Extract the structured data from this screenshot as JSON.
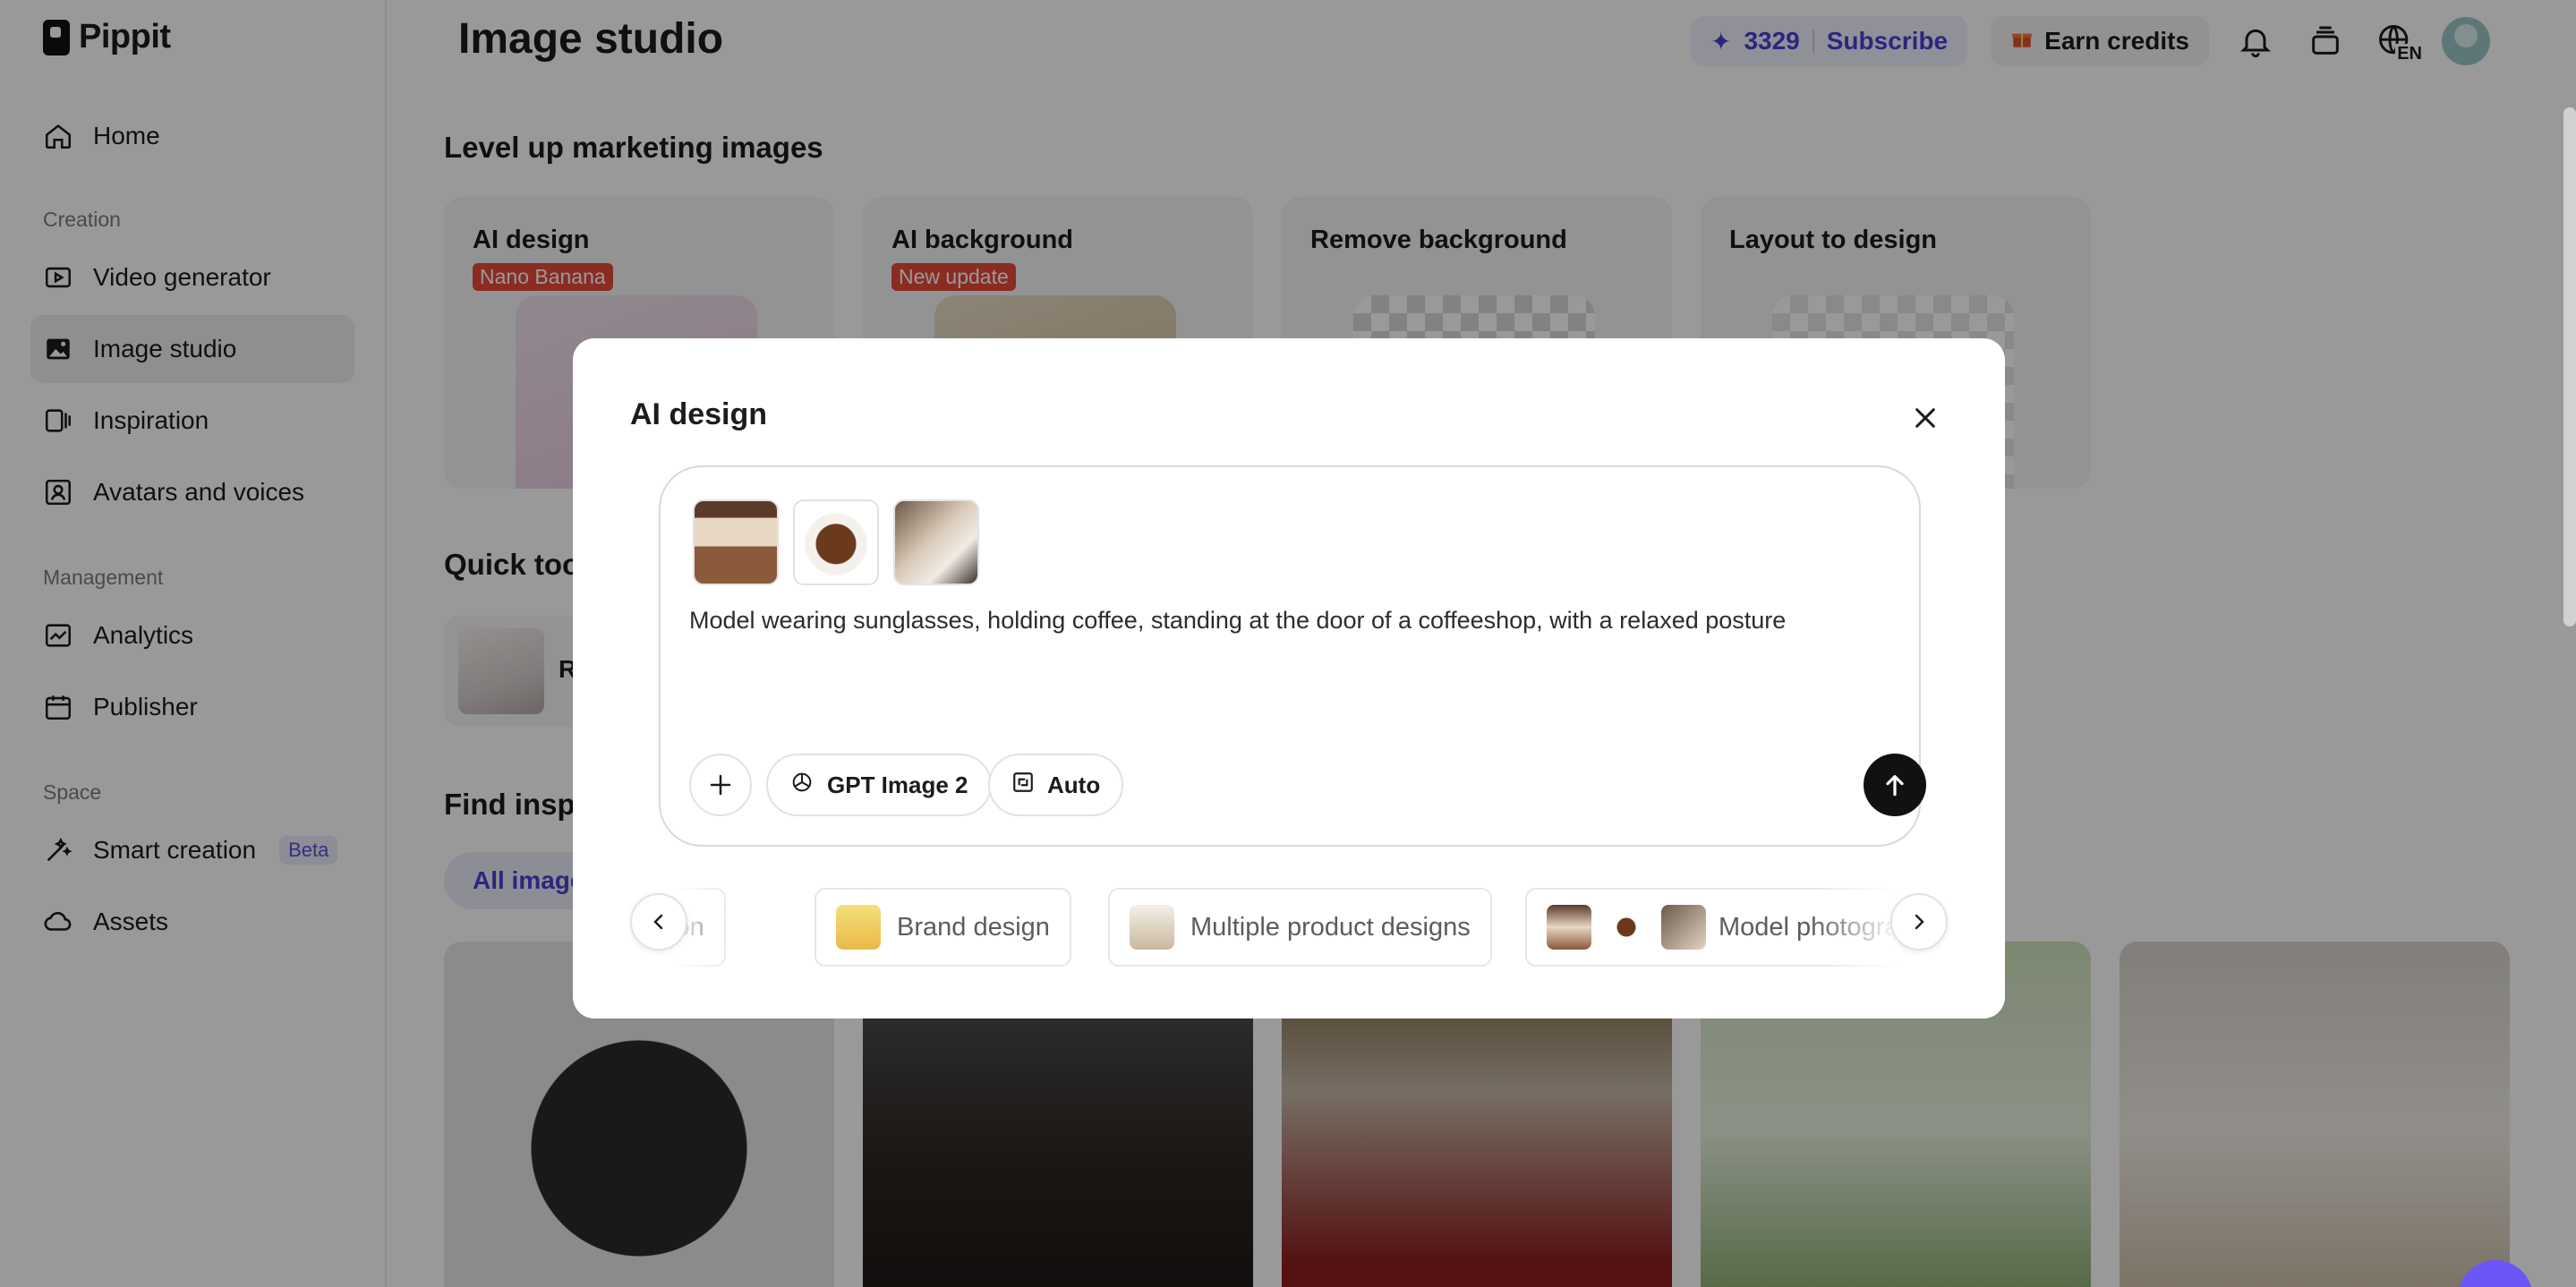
{
  "app": {
    "name": "Pippit",
    "page_title": "Image studio"
  },
  "sidebar": {
    "home": "Home",
    "section_creation": "Creation",
    "video_generator": "Video generator",
    "image_studio": "Image studio",
    "inspiration": "Inspiration",
    "avatars_voices": "Avatars and voices",
    "section_management": "Management",
    "analytics": "Analytics",
    "publisher": "Publisher",
    "section_space": "Space",
    "smart_creation": "Smart creation",
    "smart_creation_badge": "Beta",
    "assets": "Assets"
  },
  "topbar": {
    "credits": "3329",
    "subscribe": "Subscribe",
    "earn_credits": "Earn credits",
    "language": "EN"
  },
  "main": {
    "marketing_heading": "Level up marketing images",
    "cards": [
      {
        "title": "AI design",
        "badge": "Nano Banana"
      },
      {
        "title": "AI background",
        "badge": "New update"
      },
      {
        "title": "Remove background",
        "badge": ""
      },
      {
        "title": "Layout to design",
        "badge": ""
      }
    ],
    "quick_tools_heading": "Quick too",
    "quick_tool_label": "R",
    "find_heading": "Find inspi",
    "filter_all": "All image"
  },
  "modal": {
    "title": "AI design",
    "prompt": "Model wearing sunglasses, holding coffee, standing at the door of a coffeeshop, with a relaxed posture",
    "model_label": "GPT Image 2",
    "ratio_label": "Auto",
    "suggestions": [
      {
        "label": "ion"
      },
      {
        "label": "Brand design"
      },
      {
        "label": "Multiple product designs"
      },
      {
        "label": "Model photogra"
      }
    ]
  },
  "colors": {
    "accent": "#4b3fd0",
    "badge_red": "#e64a3a",
    "overlay": "rgba(0,0,0,0.40)"
  }
}
